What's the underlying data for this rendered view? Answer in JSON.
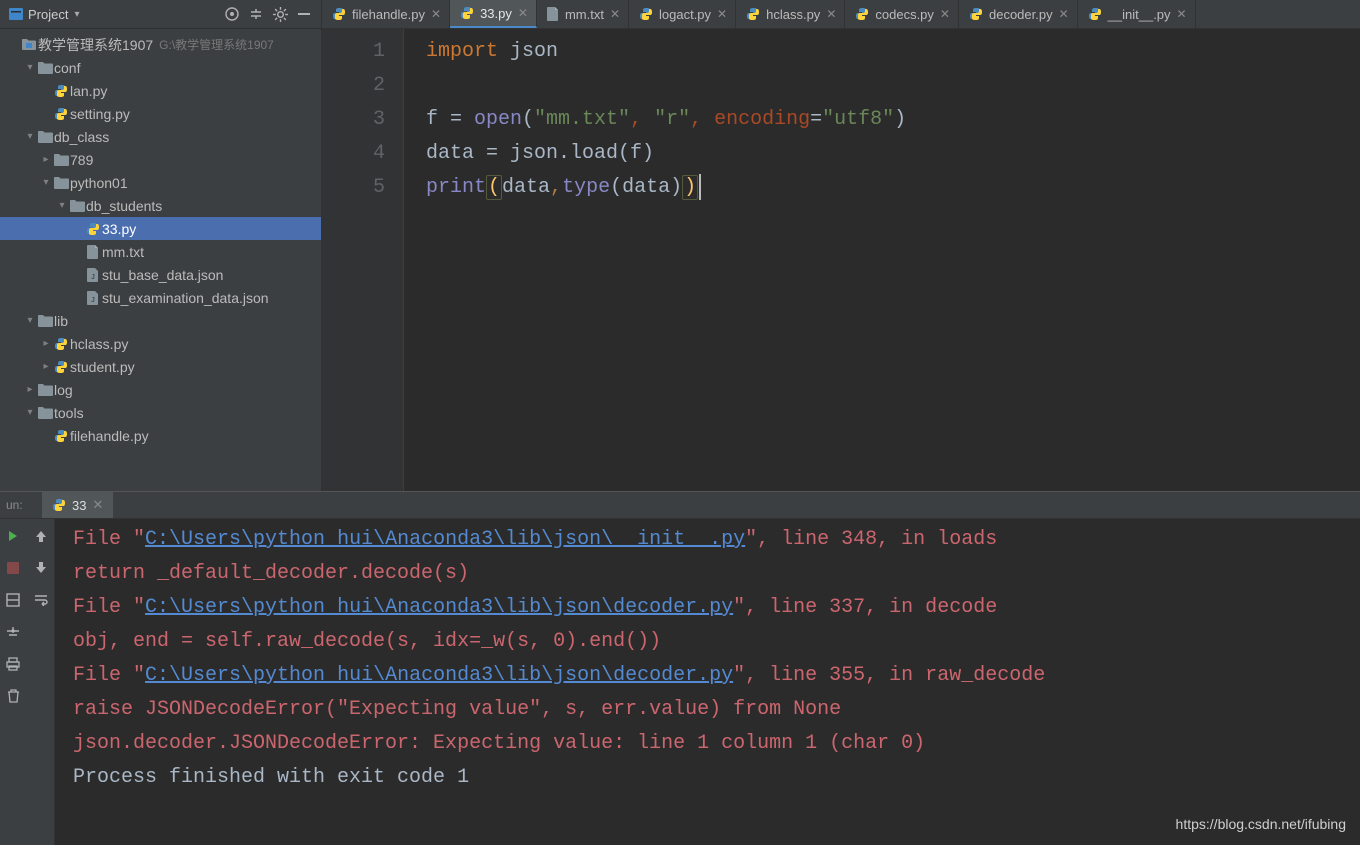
{
  "sidebar": {
    "title": "Project",
    "project_name": "教学管理系统1907",
    "project_path": "G:\\教学管理系统1907"
  },
  "tree": [
    {
      "indent": 0,
      "arrow": "",
      "iconType": "module",
      "label": "教学管理系统1907",
      "hint": "G:\\教学管理系统1907"
    },
    {
      "indent": 1,
      "arrow": "down",
      "iconType": "folder",
      "label": "conf"
    },
    {
      "indent": 2,
      "arrow": "none",
      "iconType": "py",
      "label": "lan.py"
    },
    {
      "indent": 2,
      "arrow": "none",
      "iconType": "py",
      "label": "setting.py"
    },
    {
      "indent": 1,
      "arrow": "down",
      "iconType": "folder",
      "label": "db_class"
    },
    {
      "indent": 2,
      "arrow": "right",
      "iconType": "folder",
      "label": "789"
    },
    {
      "indent": 2,
      "arrow": "down",
      "iconType": "folder",
      "label": "python01"
    },
    {
      "indent": 3,
      "arrow": "down",
      "iconType": "folder",
      "label": "db_students"
    },
    {
      "indent": 4,
      "arrow": "none",
      "iconType": "py",
      "label": "33.py",
      "selected": true
    },
    {
      "indent": 4,
      "arrow": "none",
      "iconType": "file",
      "label": "mm.txt"
    },
    {
      "indent": 4,
      "arrow": "none",
      "iconType": "json",
      "label": "stu_base_data.json"
    },
    {
      "indent": 4,
      "arrow": "none",
      "iconType": "json",
      "label": "stu_examination_data.json"
    },
    {
      "indent": 1,
      "arrow": "down",
      "iconType": "folder",
      "label": "lib"
    },
    {
      "indent": 2,
      "arrow": "right",
      "iconType": "py",
      "label": "hclass.py"
    },
    {
      "indent": 2,
      "arrow": "right",
      "iconType": "py",
      "label": "student.py"
    },
    {
      "indent": 1,
      "arrow": "right",
      "iconType": "folder",
      "label": "log"
    },
    {
      "indent": 1,
      "arrow": "down",
      "iconType": "folder",
      "label": "tools"
    },
    {
      "indent": 2,
      "arrow": "none",
      "iconType": "py",
      "label": "filehandle.py"
    }
  ],
  "tabs": [
    {
      "icon": "py",
      "label": "filehandle.py"
    },
    {
      "icon": "py",
      "label": "33.py",
      "active": true
    },
    {
      "icon": "file",
      "label": "mm.txt"
    },
    {
      "icon": "py",
      "label": "logact.py"
    },
    {
      "icon": "py",
      "label": "hclass.py"
    },
    {
      "icon": "py",
      "label": "codecs.py"
    },
    {
      "icon": "py",
      "label": "decoder.py"
    },
    {
      "icon": "py",
      "label": "__init__.py"
    }
  ],
  "editor": {
    "line_numbers": [
      "1",
      "2",
      "3",
      "4",
      "5"
    ],
    "lines": {
      "l1_import": "import",
      "l1_json": " json",
      "l3_f": "f = ",
      "l3_open": "open",
      "l3_p1": "(",
      "l3_s1": "\"mm.txt\"",
      "l3_c": ", ",
      "l3_s2": "\"r\"",
      "l3_c2": ", ",
      "l3_enc": "encoding",
      "l3_eq": "=",
      "l3_s3": "\"utf8\"",
      "l3_p2": ")",
      "l4_data": "data = json.load(f)",
      "l5_print": "print",
      "l5_p1": "(",
      "l5_data": "data",
      "l5_comma": ",",
      "l5_type": "type",
      "l5_p3": "(data)",
      "l5_p4": ")"
    }
  },
  "run": {
    "label": "un:",
    "tab": "33",
    "console": {
      "file_prefix": "  File ",
      "quote": "\"",
      "path1": "C:\\Users\\python_hui\\Anaconda3\\lib\\json\\__init__.py",
      "line1_rest": ", line 348, in loads",
      "line2": "    return _default_decoder.decode(s)",
      "path2": "C:\\Users\\python_hui\\Anaconda3\\lib\\json\\decoder.py",
      "line3_rest": ", line 337, in decode",
      "line4": "    obj, end = self.raw_decode(s, idx=_w(s, 0).end())",
      "line5_rest": ", line 355, in raw_decode",
      "line6": "    raise JSONDecodeError(\"Expecting value\", s, err.value) from None",
      "line7": "json.decoder.JSONDecodeError: Expecting value: line 1 column 1 (char 0)",
      "blank": "",
      "exit": "Process finished with exit code 1"
    }
  },
  "watermark": "https://blog.csdn.net/ifubing"
}
